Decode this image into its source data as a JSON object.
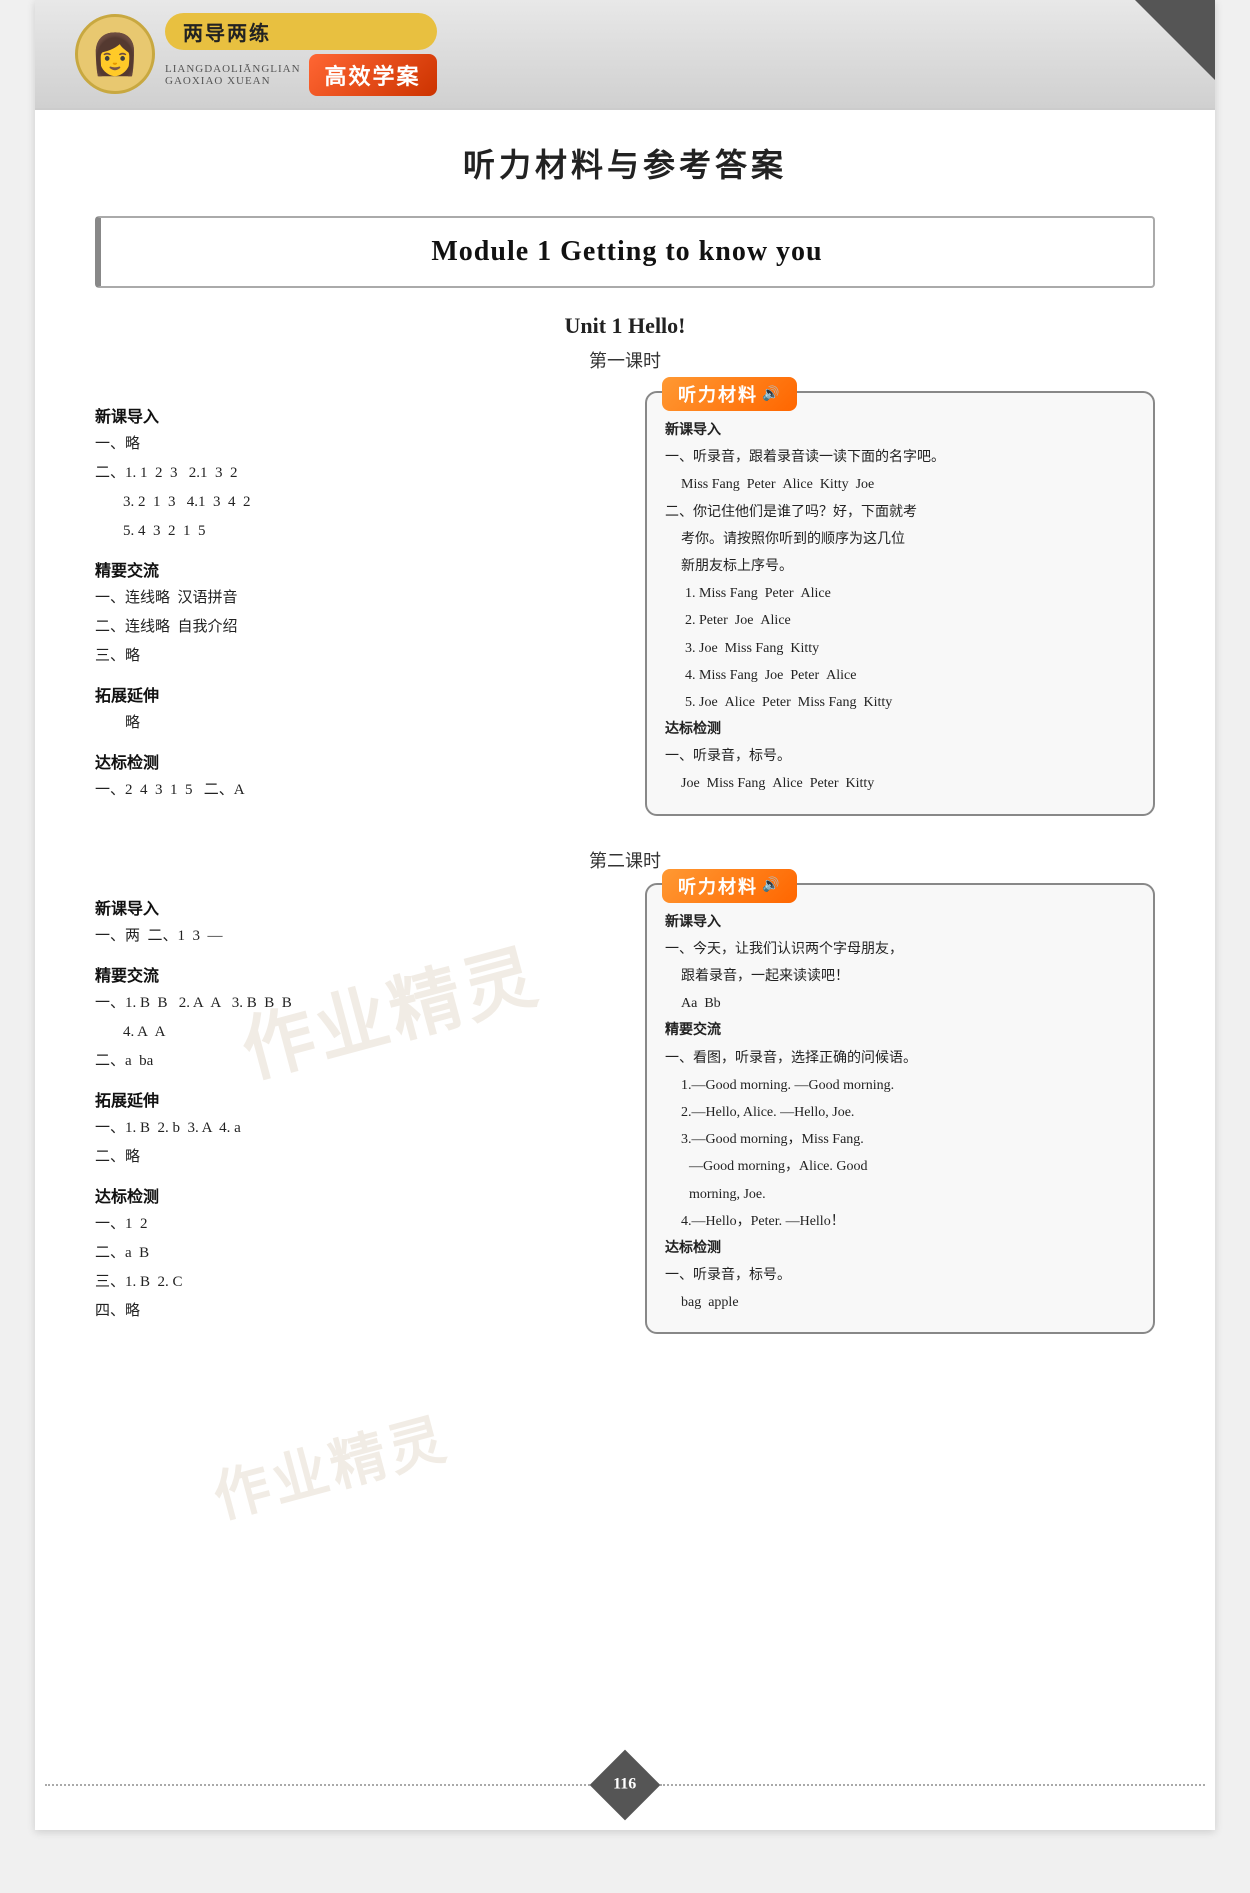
{
  "header": {
    "brand_top": "两导两练",
    "brand_pinyin": "LIANGDAOLIĀNGLIAN",
    "brand_pinyin2": "GAOXIAO XUEAN",
    "brand_chinese": "高效学案",
    "logo_figure": "👩"
  },
  "page_title": "听力材料与参考答案",
  "module_title": "Module 1 Getting to know you",
  "unit1": {
    "title": "Unit 1 Hello!",
    "lesson1": {
      "label": "第一课时",
      "left": {
        "xinkejudao_heading": "新课导入",
        "xinkejudao_content": [
          "一、略",
          "二、1. 1  2  3  2.1  3  2",
          "　　3. 2  1  3  4.1  3  4  2",
          "　　5. 4  3  2  1  5"
        ],
        "jingshijiaoliu_heading": "精要交流",
        "jingshijiaoliu_content": [
          "一、连线略  汉语拼音",
          "二、连线略  自我介绍",
          "三、略"
        ],
        "tuozhan_heading": "拓展延伸",
        "tuozhan_content": [
          "　　略"
        ],
        "dabiaojiance_heading": "达标检测",
        "dabiaojiance_content": [
          "一、2  4  3  1  5  二、A"
        ]
      },
      "right": {
        "listen_title": "听力材料",
        "xinkejudao_heading": "新课导入",
        "xinkejudao_content": [
          "一、听录音，跟着录音读一读下面的名字吧。",
          "　Miss Fang  Peter  Alice  Kitty  Joe",
          "二、你记住他们是谁了吗？好，下面就考",
          "　　考你。请按照你听到的顺序为这几位",
          "　　新朋友标上序号。",
          "　　1. Miss Fang  Peter  Alice",
          "　　2. Peter  Joe  Alice",
          "　　3. Joe  Miss Fang  Kitty",
          "　　4. Miss Fang  Joe  Peter  Alice",
          "　　5. Joe  Alice  Peter  Miss Fang  Kitty"
        ],
        "dabiao_heading": "达标检测",
        "dabiao_content": [
          "一、听录音，标号。",
          "　Joe  Miss Fang  Alice  Peter  Kitty"
        ]
      }
    },
    "lesson2": {
      "label": "第二课时",
      "left": {
        "xinkejudao_heading": "新课导入",
        "xinkejudao_content": [
          "一、两  二、1  3  —"
        ],
        "jingshijiaoliu_heading": "精要交流",
        "jingshijiaoliu_content": [
          "一、1. B  B  2. A  A  3. B  B  B",
          "　　4. A  A",
          "二、a  ba"
        ],
        "tuozhan_heading": "拓展延伸",
        "tuozhan_content": [
          "一、1. B  2. b  3. A  4. a",
          "二、略"
        ],
        "dabiao_heading": "达标检测",
        "dabiao_content": [
          "一、1  2",
          "二、a  B",
          "三、1. B  2. C",
          "四、略"
        ]
      },
      "right": {
        "listen_title": "听力材料",
        "xinkejudao_heading": "新课导入",
        "xinkejudao_content": [
          "一、今天，让我们认识两个字母朋友，",
          "　　跟着录音，一起来读读吧！",
          "　　Aa  Bb"
        ],
        "jingshijiaoliu_heading": "精要交流",
        "jingshijiaoliu_content": [
          "一、看图，听录音，选择正确的问候语。",
          "　　1.—Good morning. —Good morning.",
          "　　2.—Hello, Alice. —Hello, Joe.",
          "　　3.—Good morning，Miss Fang.",
          "　　　—Good morning，Alice. Good",
          "　　　morning, Joe.",
          "　　4.—Hello，Peter. —Hello！"
        ],
        "dabiao_heading": "达标检测",
        "dabiao_content": [
          "一、听录音，标号。",
          "　bag  apple"
        ]
      }
    }
  },
  "watermark": "作业精灵",
  "page_number": "116"
}
